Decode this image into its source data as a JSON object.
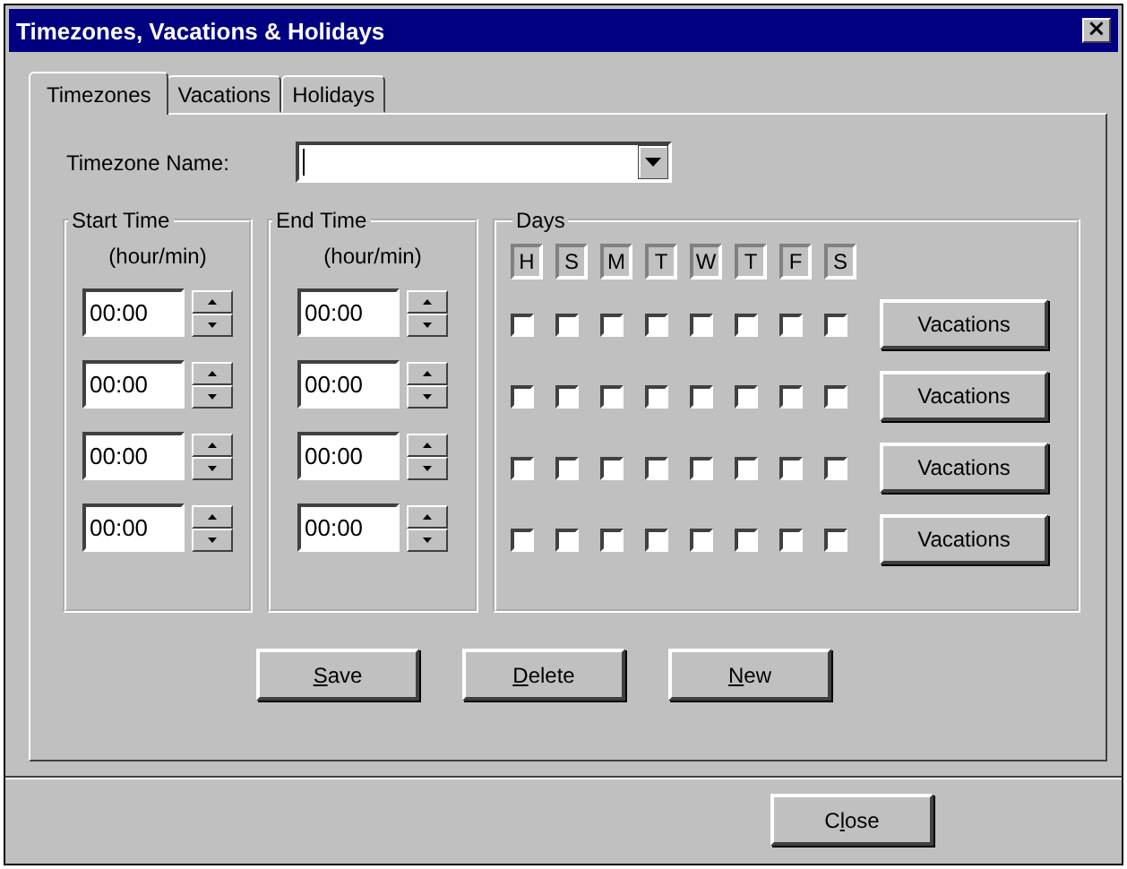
{
  "window": {
    "title": "Timezones, Vacations & Holidays",
    "close_glyph": "×"
  },
  "tabs": [
    {
      "label": "Timezones",
      "selected": true
    },
    {
      "label": "Vacations",
      "selected": false
    },
    {
      "label": "Holidays",
      "selected": false
    }
  ],
  "timezone_name": {
    "label": "Timezone Name:"
  },
  "start_group": {
    "title": "Start Time",
    "hint": "(hour/min)"
  },
  "end_group": {
    "title": "End Time",
    "hint": "(hour/min)"
  },
  "days_group": {
    "title": "Days",
    "headers": [
      "H",
      "S",
      "M",
      "T",
      "W",
      "T",
      "F",
      "S"
    ]
  },
  "rows": [
    {
      "start": "00:00",
      "end": "00:00",
      "days": [
        false,
        false,
        false,
        false,
        false,
        false,
        false,
        false
      ],
      "button": "Vacations"
    },
    {
      "start": "00:00",
      "end": "00:00",
      "days": [
        false,
        false,
        false,
        false,
        false,
        false,
        false,
        false
      ],
      "button": "Vacations"
    },
    {
      "start": "00:00",
      "end": "00:00",
      "days": [
        false,
        false,
        false,
        false,
        false,
        false,
        false,
        false
      ],
      "button": "Vacations"
    },
    {
      "start": "00:00",
      "end": "00:00",
      "days": [
        false,
        false,
        false,
        false,
        false,
        false,
        false,
        false
      ],
      "button": "Vacations"
    }
  ],
  "actions": [
    {
      "key": "S",
      "post": "ave"
    },
    {
      "key": "D",
      "post": "elete"
    },
    {
      "key": "N",
      "post": "ew"
    }
  ],
  "footer": [
    {
      "pre": "C",
      "key": "l",
      "post": "ose"
    }
  ]
}
